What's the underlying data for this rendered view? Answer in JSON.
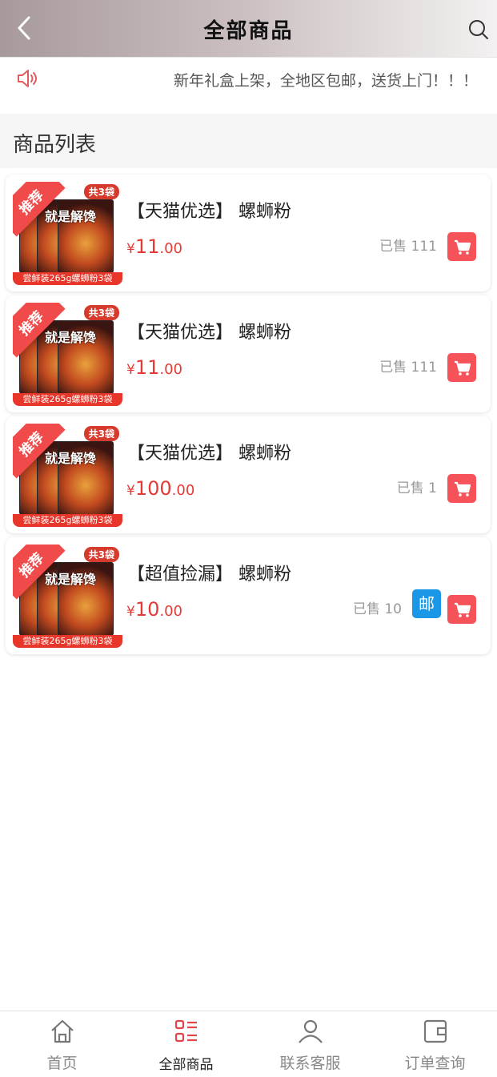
{
  "header": {
    "title": "全部商品",
    "back_icon": "chevron-left-icon",
    "search_icon": "search-icon"
  },
  "notice": {
    "icon": "speaker-icon",
    "text": "新年礼盒上架，全地区包邮，送货上门！！！"
  },
  "section": {
    "title": "商品列表"
  },
  "thumbnail": {
    "ribbon": "推荐",
    "count_tag": "共3袋",
    "headline": "就是解馋",
    "bottom_text": "尝鲜装265g螺蛳粉3袋"
  },
  "products": [
    {
      "name": "【天猫优选】 螺蛳粉",
      "currency": "¥",
      "price_int": "11",
      "price_dec": ".00",
      "sold": "已售 111",
      "mail": ""
    },
    {
      "name": "【天猫优选】 螺蛳粉",
      "currency": "¥",
      "price_int": "11",
      "price_dec": ".00",
      "sold": "已售 111",
      "mail": ""
    },
    {
      "name": "【天猫优选】 螺蛳粉",
      "currency": "¥",
      "price_int": "100",
      "price_dec": ".00",
      "sold": "已售 1",
      "mail": ""
    },
    {
      "name": "【超值捡漏】 螺蛳粉",
      "currency": "¥",
      "price_int": "10",
      "price_dec": ".00",
      "sold": "已售 10",
      "mail": "邮"
    }
  ],
  "tabs": [
    {
      "label": "首页",
      "icon": "home-icon"
    },
    {
      "label": "全部商品",
      "icon": "list-icon"
    },
    {
      "label": "联系客服",
      "icon": "user-icon"
    },
    {
      "label": "订单查询",
      "icon": "wallet-icon"
    }
  ],
  "colors": {
    "accent": "#f5525a",
    "price": "#e53935",
    "mail": "#1a97e6",
    "active_tab_icon": "#e0454c"
  }
}
